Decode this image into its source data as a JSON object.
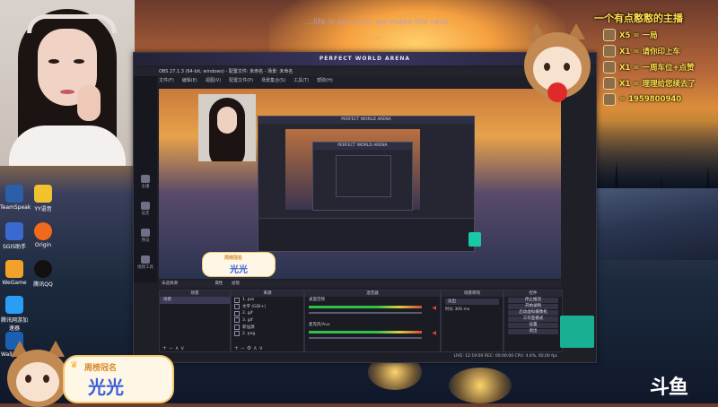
{
  "stream_caption": {
    "line1": "...life is our race, we make the race",
    "line2": "..."
  },
  "gift_panel": {
    "title": "一个有点憨憨的主播",
    "rows": [
      {
        "text": "X5 = 一局"
      },
      {
        "text": "X1 = 请你印上车"
      },
      {
        "text": "X1 = 一周车位+点赞"
      },
      {
        "text": "X1 = 理理给您续去了"
      },
      {
        "text": "= 1959800940"
      }
    ]
  },
  "desktop_icons": [
    {
      "label": "TeamSpeak"
    },
    {
      "label": "YY语音"
    },
    {
      "label": "SGIS助手"
    },
    {
      "label": "Origin"
    },
    {
      "label": "WeGame"
    },
    {
      "label": "腾讯QQ"
    },
    {
      "label": "腾讯网游加速器"
    },
    {
      "label": "Wallpaper"
    }
  ],
  "obs": {
    "banner": "PERFECT WORLD ARENA",
    "title": "OBS 27.1.3 (64-bit, windows) - 配置文件: 未命名 - 场景: 未命名",
    "menu": [
      "文件(F)",
      "编辑(E)",
      "视图(V)",
      "配置文件(P)",
      "场景集合(S)",
      "工具(T)",
      "帮助(H)"
    ],
    "left_buttons": [
      "主播",
      "设定",
      "预设",
      "视频工具"
    ],
    "nested_banner": "PERFECT WORLD ARENA",
    "dock_header": [
      "未选择源",
      "属性",
      "滤镜"
    ],
    "scenes": {
      "title": "场景",
      "items": [
        "场景"
      ]
    },
    "sources": {
      "title": "来源",
      "items": [
        "1. pss",
        "文字 (GDI+)",
        "2. gif",
        "3. gif",
        "新仙源",
        "2. png"
      ]
    },
    "mixer": {
      "title": "混音器",
      "tracks": [
        "桌面音频",
        "麦克风/Aux"
      ]
    },
    "transitions": {
      "title": "场景转场",
      "type": "淡出",
      "duration_label": "时长",
      "duration": "300 ms"
    },
    "controls": {
      "title": "控件",
      "buttons": [
        "停止推流",
        "开始录制",
        "启动虚拟摄像机",
        "工作室模式",
        "设置",
        "退出"
      ]
    },
    "status": "LIVE: 12:19:00  REC: 00:00:00  CPU: 4.4%, 60.00 fps"
  },
  "name_card": {
    "title": "周榜冠名",
    "name": "光光"
  },
  "preview_card": {
    "title": "周榜冠名",
    "name": "光光"
  },
  "logo": "斗鱼",
  "colors": {
    "gift_text": "#ffe04a",
    "card_name": "#3b5fd8",
    "obs_bg": "#1f1f28"
  }
}
